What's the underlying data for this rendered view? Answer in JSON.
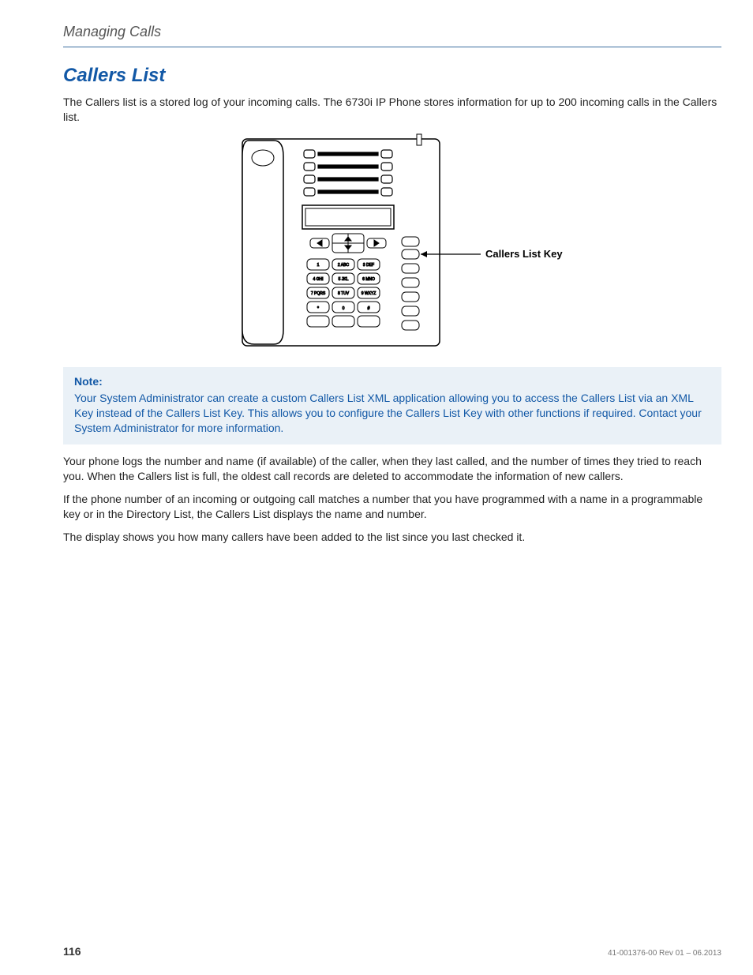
{
  "header": {
    "breadcrumb": "Managing Calls"
  },
  "section": {
    "title": "Callers List",
    "intro": "The Callers list is a stored log of your incoming calls. The 6730i IP Phone stores information for up to 200 incoming calls in the Callers list.",
    "figure_callout": "Callers List Key",
    "note_title": "Note:",
    "note_body": "Your System Administrator can create a custom Callers List XML application allowing you to access the Callers List via an XML Key instead of the Callers List Key. This allows you to configure the Callers List Key with other functions if required. Contact your System Administrator for more information.",
    "para1": "Your phone logs the number and name (if available) of the caller, when they last called, and the number of times they tried to reach you. When the Callers list is full, the oldest call records are deleted to accommodate the information of new callers.",
    "para2": "If the phone number of an incoming or outgoing call matches a number that you have programmed with a name in a programmable key or in the Directory List, the Callers List displays the name and number.",
    "para3": "The display shows you how many callers have been added to the list since you last checked it."
  },
  "footer": {
    "page": "116",
    "docid": "41-001376-00 Rev 01 – 06.2013"
  },
  "keypad": {
    "r1": [
      "1",
      "2ABC",
      "3DEF"
    ],
    "r2": [
      "4GHI",
      "5JKL",
      "6MNO"
    ],
    "r3": [
      "7PQRS",
      "8TUV",
      "9WXYZ"
    ],
    "r4": [
      "*",
      "0",
      "#"
    ]
  }
}
